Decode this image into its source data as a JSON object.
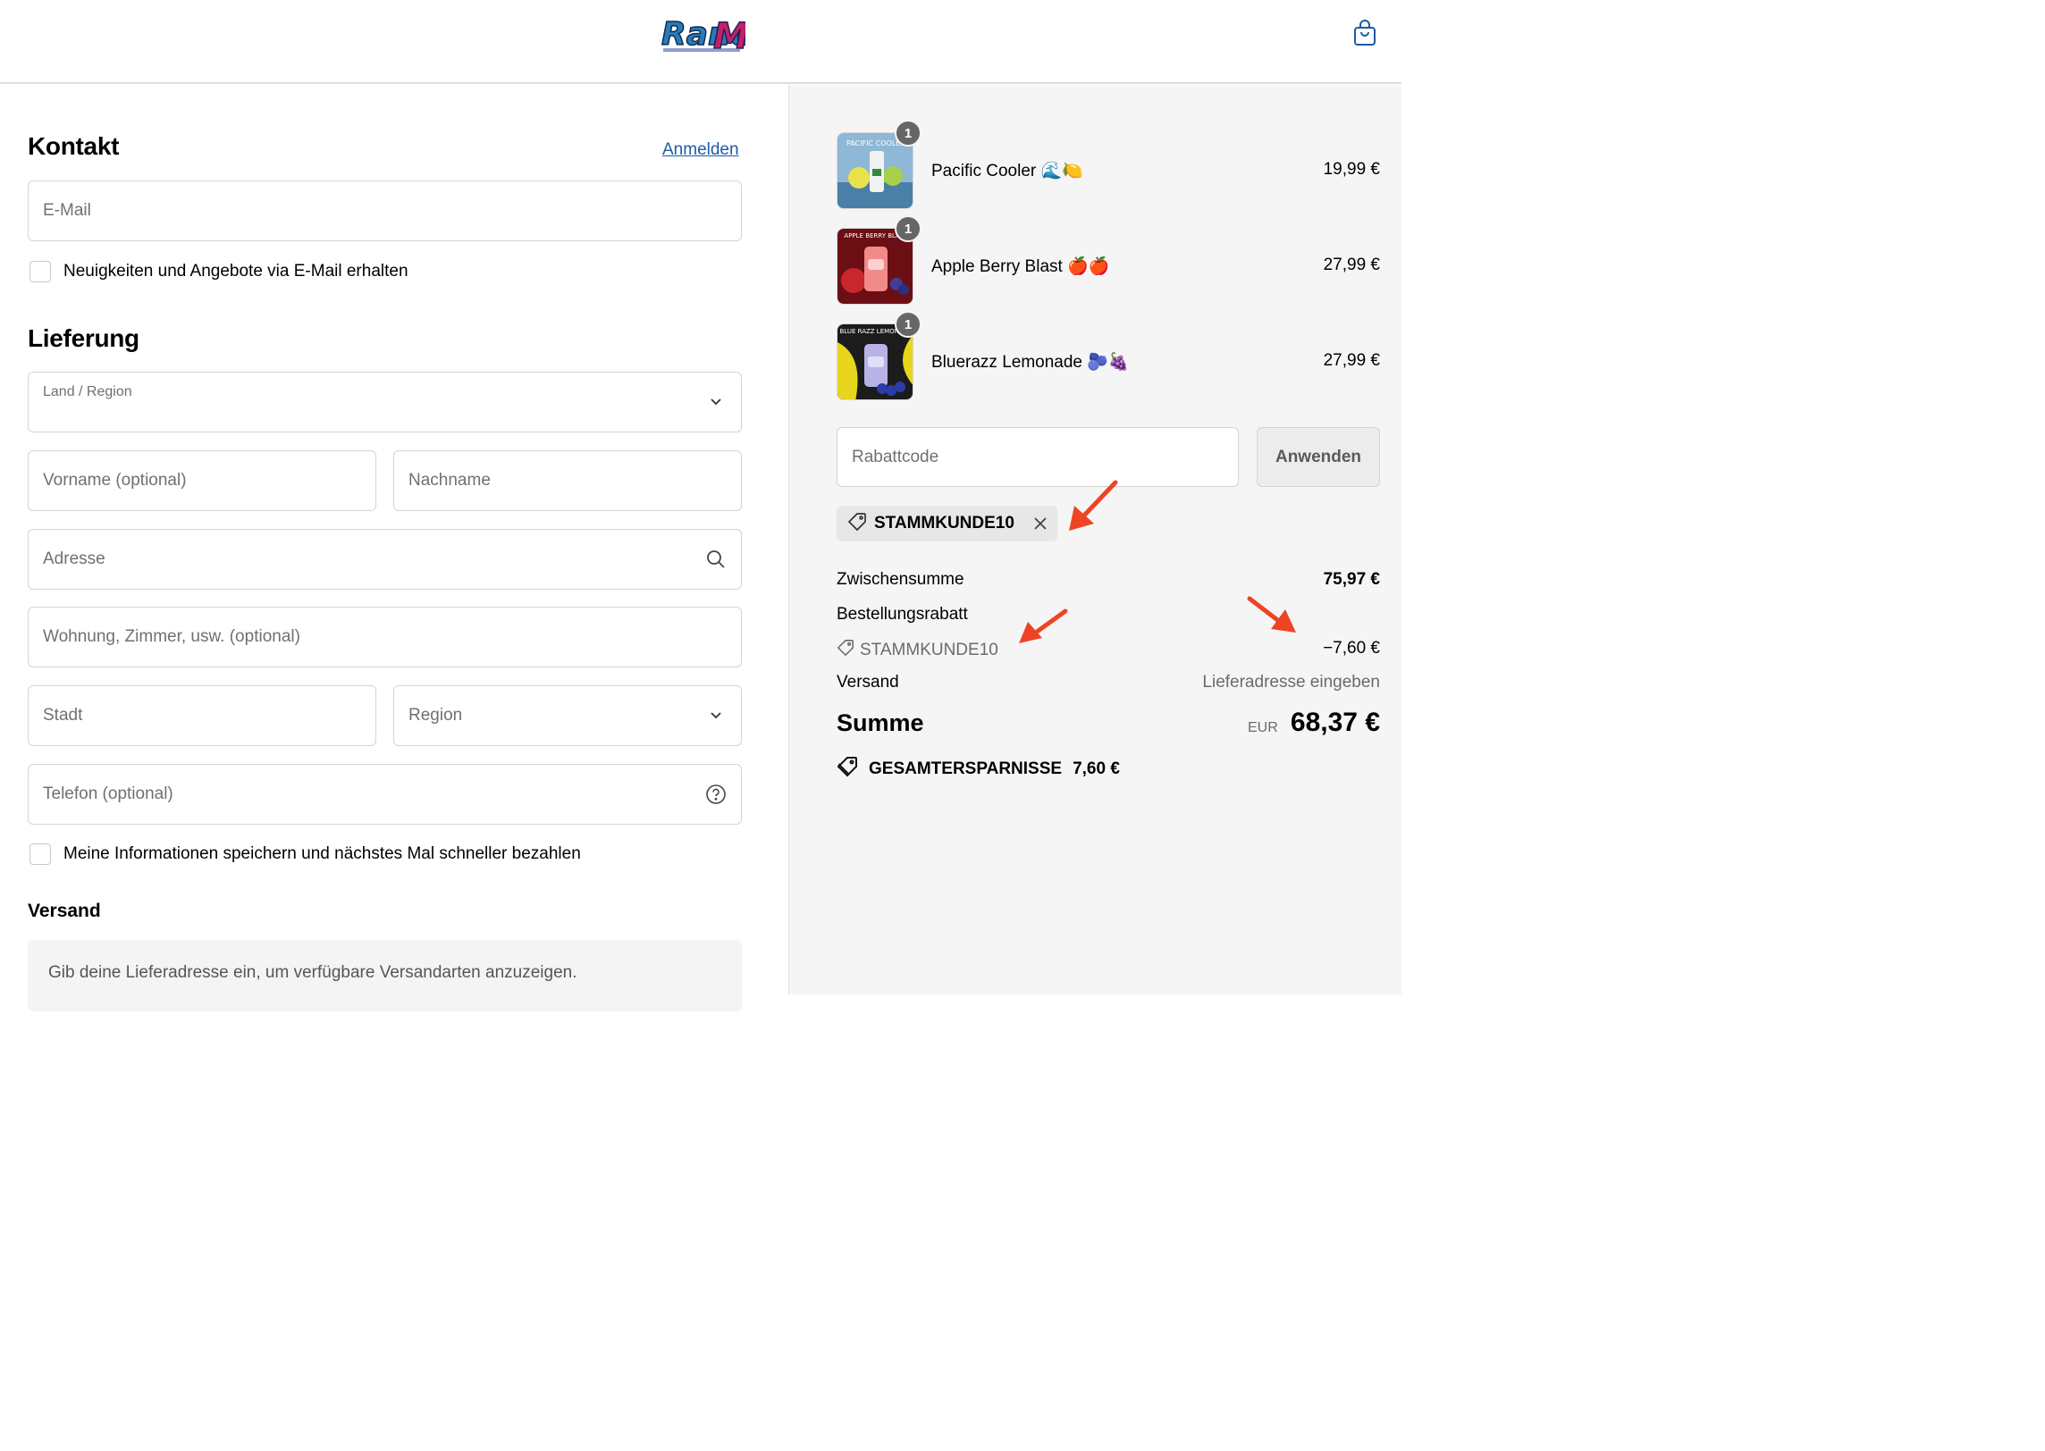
{
  "header": {
    "logo_text": "RandM",
    "cart_icon": "shopping-bag-icon"
  },
  "contact": {
    "title": "Kontakt",
    "login_link": "Anmelden",
    "email_placeholder": "E-Mail",
    "newsletter_label": "Neuigkeiten und Angebote via E-Mail erhalten"
  },
  "delivery": {
    "title": "Lieferung",
    "country_label": "Land / Region",
    "firstname_placeholder": "Vorname (optional)",
    "lastname_placeholder": "Nachname",
    "address_placeholder": "Adresse",
    "apartment_placeholder": "Wohnung, Zimmer, usw. (optional)",
    "city_placeholder": "Stadt",
    "region_placeholder": "Region",
    "phone_placeholder": "Telefon (optional)",
    "save_info_label": "Meine Informationen speichern und nächstes Mal schneller bezahlen"
  },
  "shipping": {
    "title": "Versand",
    "notice": "Gib deine Lieferadresse ein, um verfügbare Versandarten anzuzeigen."
  },
  "cart": {
    "items": [
      {
        "name": "Pacific Cooler 🌊🍋",
        "price": "19,99 €",
        "qty": "1",
        "thumb_text": "PACIFIC COOLER",
        "thumb_color": "#6f9fc4"
      },
      {
        "name": "Apple Berry Blast 🍎🍎",
        "price": "27,99 €",
        "qty": "1",
        "thumb_text": "APPLE BERRY BLAST",
        "thumb_color": "#b2232b"
      },
      {
        "name": "Bluerazz Lemonade 🫐🍇",
        "price": "27,99 €",
        "qty": "1",
        "thumb_text": "BLUE RAZZ LEMONADE",
        "thumb_color": "#e7d51e"
      }
    ]
  },
  "discount": {
    "placeholder": "Rabattcode",
    "apply_label": "Anwenden",
    "applied_code": "STAMMKUNDE10"
  },
  "summary": {
    "subtotal_label": "Zwischensumme",
    "subtotal_value": "75,97 €",
    "order_discount_label": "Bestellungsrabatt",
    "discount_code": "STAMMKUNDE10",
    "discount_value": "−7,60 €",
    "shipping_label": "Versand",
    "shipping_value": "Lieferadresse eingeben",
    "total_label": "Summe",
    "currency": "EUR",
    "total_value": "68,37 €",
    "savings_label": "GESAMTERSPARNISSE",
    "savings_value": "7,60 €"
  },
  "colors": {
    "link": "#1b5ba8",
    "annotation_arrow": "#ee4423",
    "sidebar_bg": "#f5f5f5"
  }
}
